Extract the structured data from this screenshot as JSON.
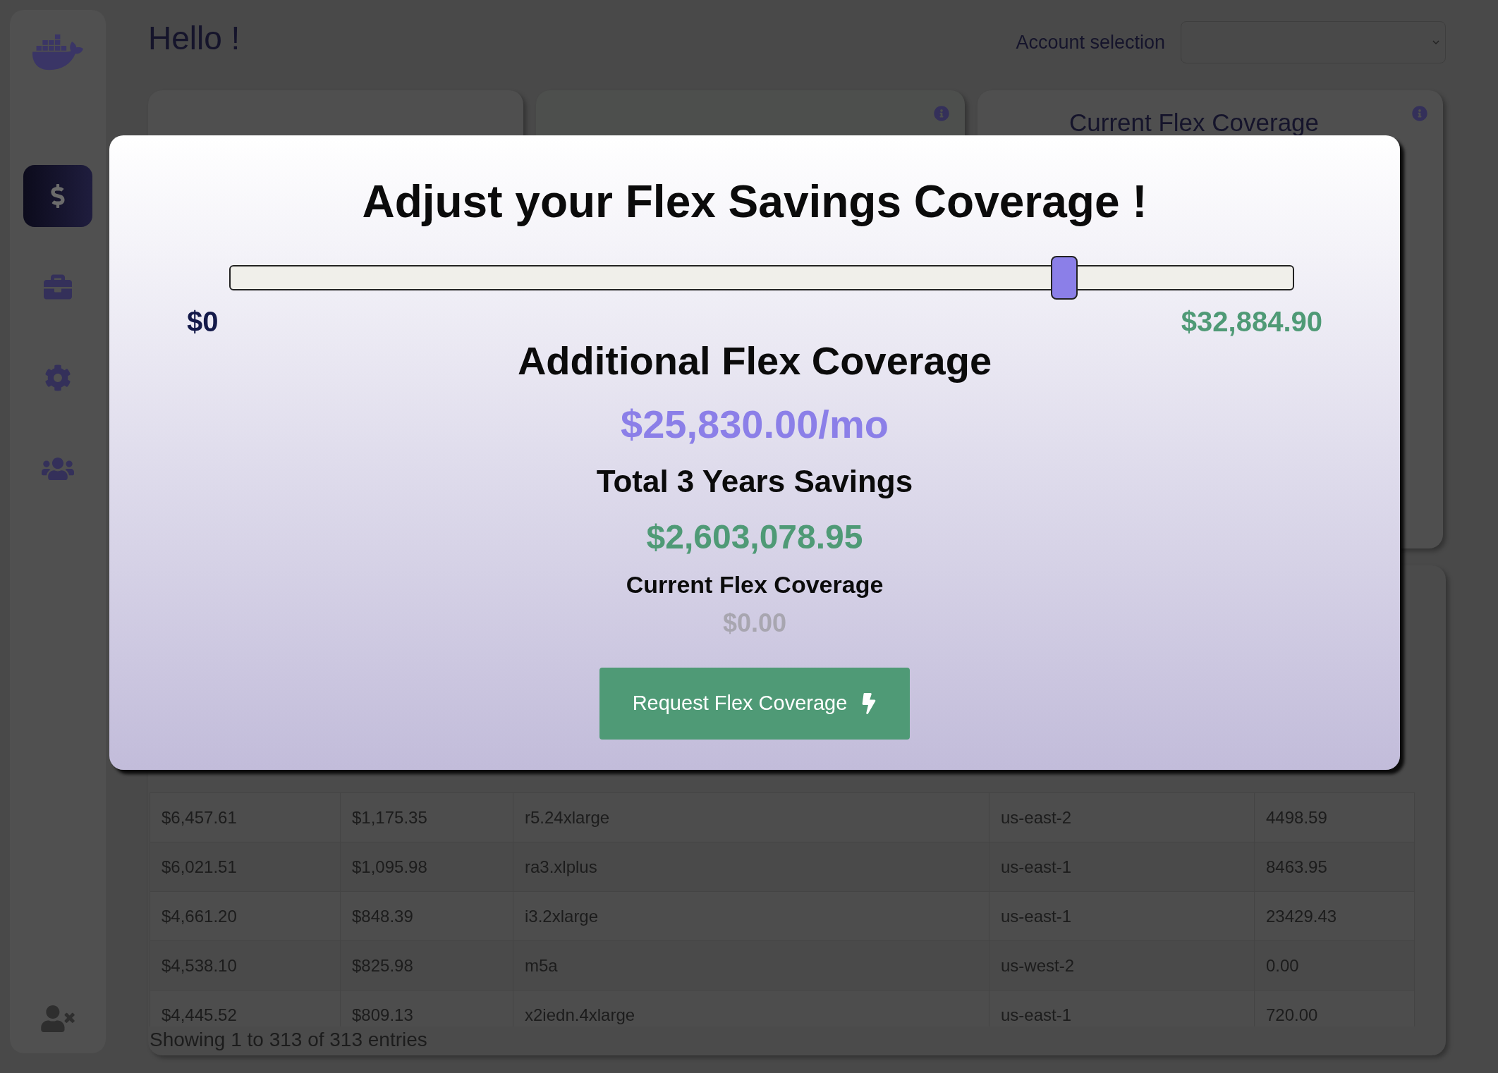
{
  "sidebar": {
    "items": [
      {
        "kind": "dollar",
        "selected": true
      },
      {
        "kind": "briefcase",
        "selected": false
      },
      {
        "kind": "gear",
        "selected": false
      },
      {
        "kind": "users",
        "selected": false
      }
    ]
  },
  "header": {
    "greeting": "Hello !",
    "account_label": "Account selection"
  },
  "summary_card": {
    "title": "Current Flex Coverage"
  },
  "table": {
    "rows": [
      [
        "$6,457.61",
        "$1,175.35",
        "r5.24xlarge",
        "us-east-2",
        "4498.59"
      ],
      [
        "$6,021.51",
        "$1,095.98",
        "ra3.xlplus",
        "us-east-1",
        "8463.95"
      ],
      [
        "$4,661.20",
        "$848.39",
        "i3.2xlarge",
        "us-east-1",
        "23429.43"
      ],
      [
        "$4,538.10",
        "$825.98",
        "m5a",
        "us-west-2",
        "0.00"
      ],
      [
        "$4,445.52",
        "$809.13",
        "x2iedn.4xlarge",
        "us-east-1",
        "720.00"
      ]
    ],
    "footer": "Showing 1 to 313 of 313 entries"
  },
  "modal": {
    "title": "Adjust your Flex Savings Coverage !",
    "slider": {
      "level": 0.785,
      "min_label": "$0",
      "max_label": "$32,884.90"
    },
    "additional_label": "Additional Flex Coverage",
    "additional_value": "$25,830.00/mo",
    "savings_label": "Total 3 Years Savings",
    "savings_value": "$2,603,078.95",
    "current_label": "Current Flex Coverage",
    "current_value": "$0.00",
    "button": "Request Flex Coverage"
  }
}
